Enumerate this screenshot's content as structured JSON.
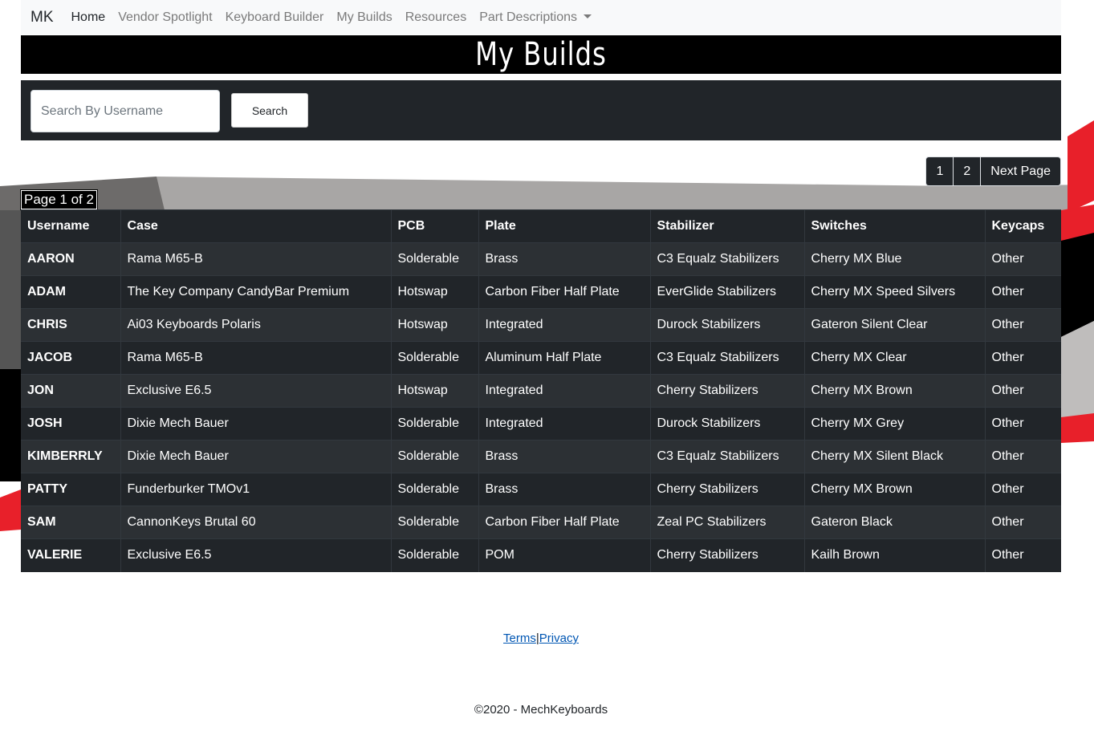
{
  "nav": {
    "brand": "MK",
    "items": [
      {
        "label": "Home"
      },
      {
        "label": "Vendor Spotlight"
      },
      {
        "label": "Keyboard Builder"
      },
      {
        "label": "My Builds"
      },
      {
        "label": "Resources"
      },
      {
        "label": "Part Descriptions"
      }
    ]
  },
  "banner": {
    "title": "My Builds"
  },
  "search": {
    "placeholder": "Search By Username",
    "value": "",
    "button_label": "Search"
  },
  "pagination": {
    "pages": [
      "1",
      "2"
    ],
    "next_label": "Next Page",
    "page_label": "Page 1 of 2"
  },
  "table": {
    "headers": [
      "Username",
      "Case",
      "PCB",
      "Plate",
      "Stabilizer",
      "Switches",
      "Keycaps"
    ],
    "rows": [
      [
        "AARON",
        "Rama M65-B",
        "Solderable",
        "Brass",
        "C3 Equalz Stabilizers",
        "Cherry MX Blue",
        "Other"
      ],
      [
        "ADAM",
        "The Key Company CandyBar Premium",
        "Hotswap",
        "Carbon Fiber Half Plate",
        "EverGlide Stabilizers",
        "Cherry MX Speed Silvers",
        "Other"
      ],
      [
        "CHRIS",
        "Ai03 Keyboards Polaris",
        "Hotswap",
        "Integrated",
        "Durock Stabilizers",
        "Gateron Silent Clear",
        "Other"
      ],
      [
        "JACOB",
        "Rama M65-B",
        "Solderable",
        "Aluminum Half Plate",
        "C3 Equalz Stabilizers",
        "Cherry MX Clear",
        "Other"
      ],
      [
        "JON",
        "Exclusive E6.5",
        "Hotswap",
        "Integrated",
        "Cherry Stabilizers",
        "Cherry MX Brown",
        "Other"
      ],
      [
        "JOSH",
        "Dixie Mech Bauer",
        "Solderable",
        "Integrated",
        "Durock Stabilizers",
        "Cherry MX Grey",
        "Other"
      ],
      [
        "KIMBERRLY",
        "Dixie Mech Bauer",
        "Solderable",
        "Brass",
        "C3 Equalz Stabilizers",
        "Cherry MX Silent Black",
        "Other"
      ],
      [
        "PATTY",
        "Funderburker TMOv1",
        "Solderable",
        "Brass",
        "Cherry Stabilizers",
        "Cherry MX Brown",
        "Other"
      ],
      [
        "SAM",
        "CannonKeys Brutal 60",
        "Solderable",
        "Carbon Fiber Half Plate",
        "Zeal PC Stabilizers",
        "Gateron Black",
        "Other"
      ],
      [
        "VALERIE",
        "Exclusive E6.5",
        "Solderable",
        "POM",
        "Cherry Stabilizers",
        "Kailh Brown",
        "Other"
      ]
    ]
  },
  "footer": {
    "terms": "Terms",
    "separator": "|",
    "privacy": "Privacy",
    "copyright": "©2020 - MechKeyboards"
  },
  "colors": {
    "dark": "#212529",
    "accent_red": "#e8202a",
    "banner": "#000000"
  }
}
